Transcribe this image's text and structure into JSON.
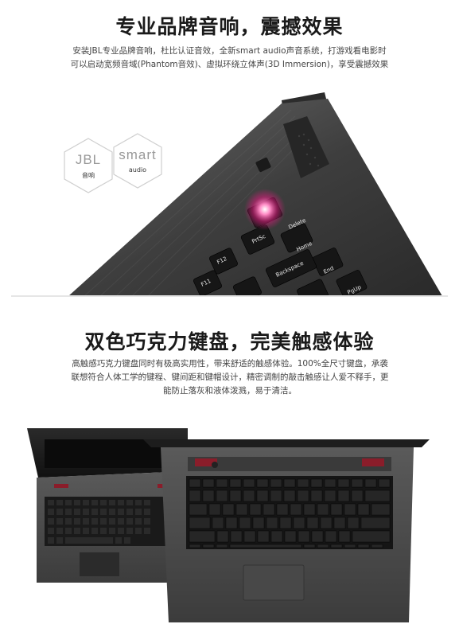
{
  "section1": {
    "title": "专业品牌音响，震撼效果",
    "desc_line1": "安装JBL专业品牌音响，杜比认证音效，全新smart audio声音系统，打游戏看电影时",
    "desc_line2": "可以启动宽频音域(Phantom音效)、虚拟环绕立体声(3D Immersion)，享受震撼效果",
    "badge_jbl": {
      "big": "JBL",
      "small": "音响"
    },
    "badge_smart": {
      "big": "smart",
      "small": "audio"
    },
    "keys": [
      "Delete",
      "PrtSc",
      "SysRq",
      "Home",
      "Pause",
      "End",
      "Break",
      "Backspace",
      "F12",
      "F11",
      "PgUp",
      "ScrLk"
    ]
  },
  "section2": {
    "title": "双色巧克力键盘，完美触感体验",
    "desc_line1": "高触感巧克力键盘同时有极高实用性，带来舒适的触感体验。100%全尺寸键盘，承袭",
    "desc_line2": "联想符合人体工学的键程、键间距和键帽设计，精密调制的敲击触感让人爱不释手，更",
    "desc_line3": "能防止落灰和液体泼溅，易于清洁。"
  },
  "colors": {
    "title": "#1a1a1a",
    "text": "#444444",
    "laptop_body": "#4a4a4a",
    "key": "#1c1c1c",
    "accent_led": "#ff4fa0"
  }
}
